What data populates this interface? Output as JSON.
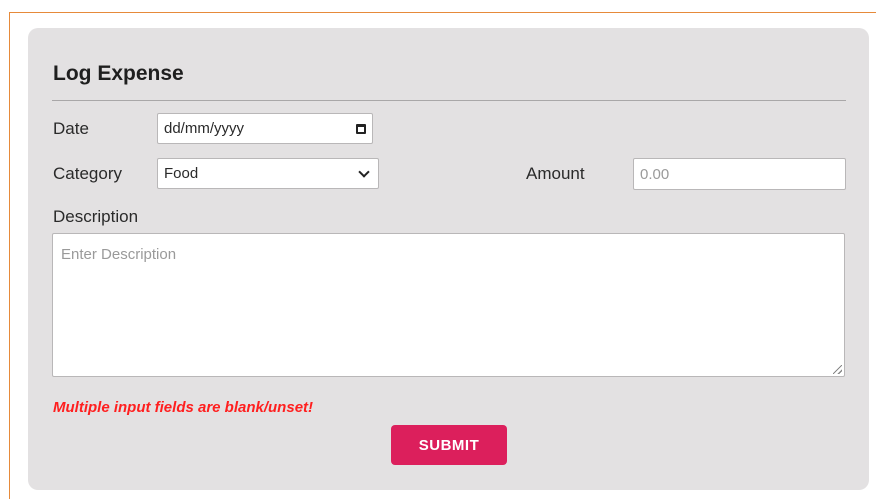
{
  "form": {
    "title": "Log Expense",
    "date": {
      "label": "Date",
      "placeholder": "dd/mm/yyyy"
    },
    "category": {
      "label": "Category",
      "selected": "Food"
    },
    "amount": {
      "label": "Amount",
      "placeholder": "0.00"
    },
    "description": {
      "label": "Description",
      "placeholder": "Enter Description"
    },
    "error_message": "Multiple input fields are blank/unset!",
    "submit_label": "SUBMIT"
  },
  "colors": {
    "card_background": "#e3e1e2",
    "frame_border": "#e68a3a",
    "error": "#ff1f1f",
    "submit_button": "#dc1f5c"
  },
  "icons": {
    "date": "calendar-icon",
    "category": "chevron-down-icon",
    "description": "resize-handle-icon"
  }
}
